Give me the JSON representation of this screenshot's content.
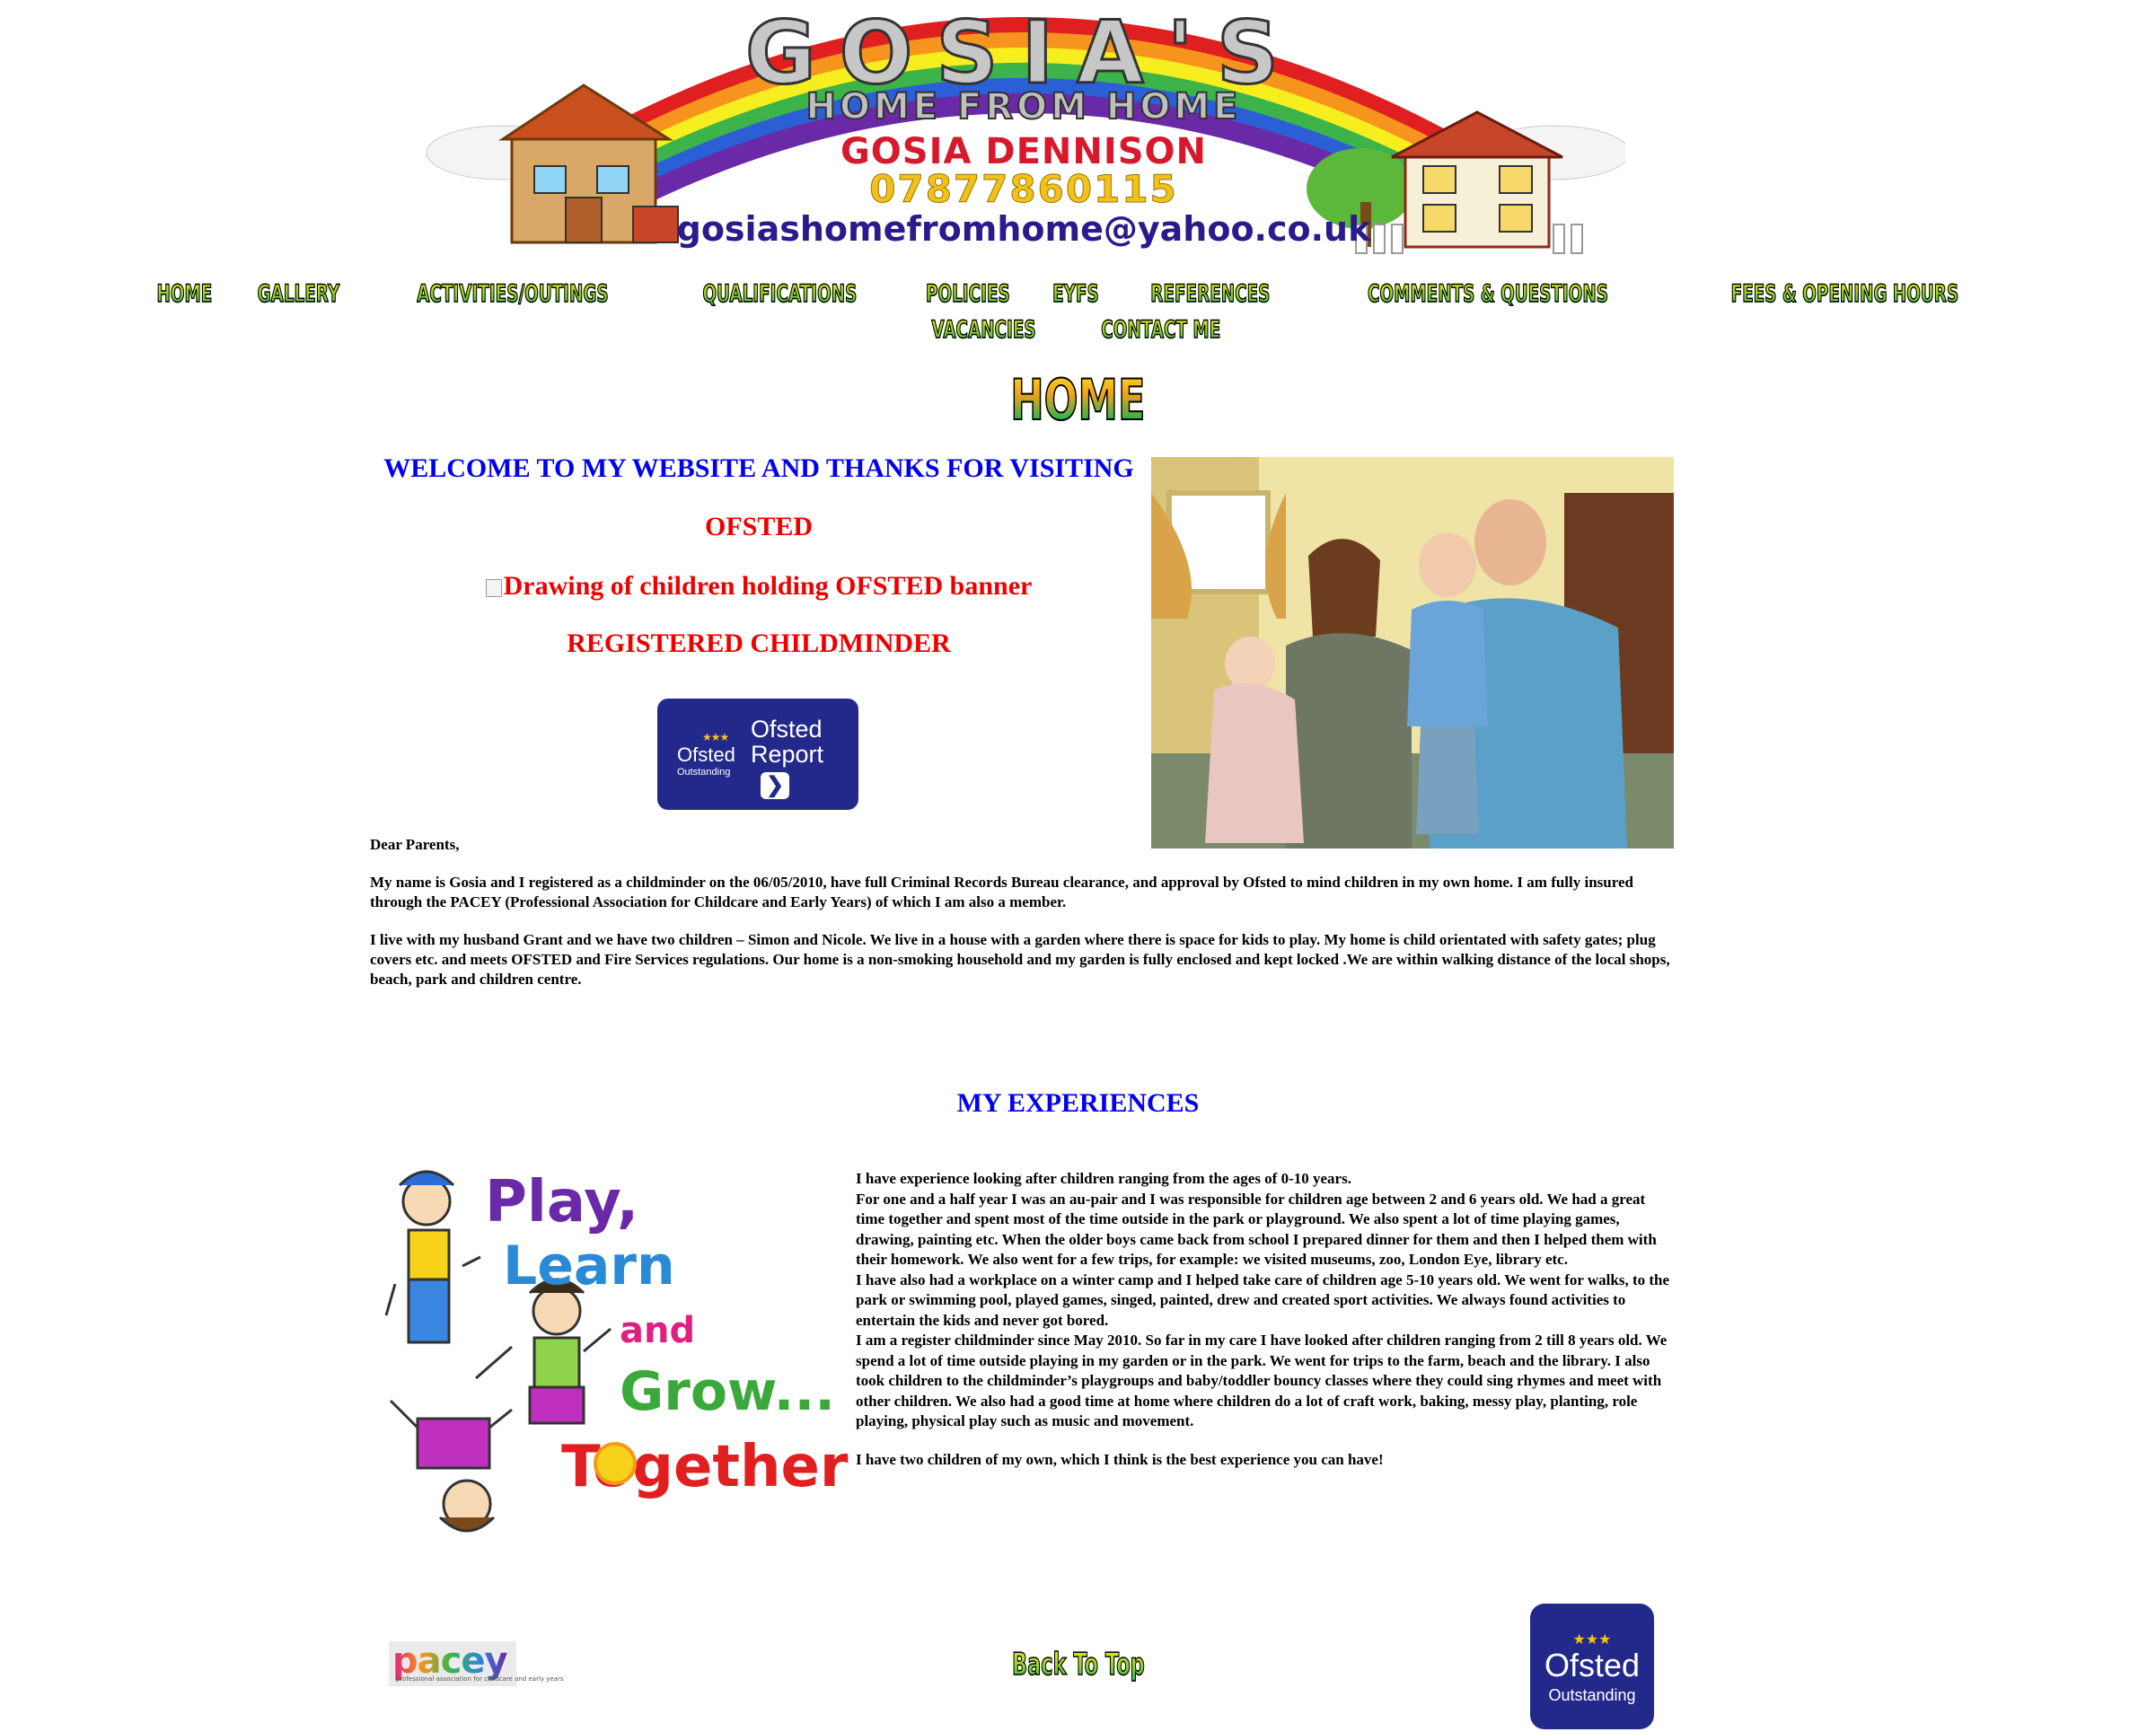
{
  "banner": {
    "title": "GOSIA'S",
    "subtitle": "HOME FROM HOME",
    "name": "GOSIA DENNISON",
    "phone": "07877860115",
    "email": "gosiashomefromhome@yahoo.co.uk"
  },
  "nav": {
    "row1": [
      "HOME",
      "GALLERY",
      "ACTIVITIES/OUTINGS",
      "QUALIFICATIONS",
      "POLICIES",
      "EYFS",
      "REFERENCES",
      "COMMENTS & QUESTIONS",
      "FEES & OPENING HOURS"
    ],
    "row2": [
      "VACANCIES",
      "CONTACT ME"
    ]
  },
  "page_heading": "HOME",
  "welcome": {
    "heading": "WELCOME TO MY WEBSITE AND THANKS FOR VISITING",
    "ofsted": "OFSTED",
    "ofsted_image_alt": "Drawing of children holding OFSTED banner",
    "registered": "REGISTERED CHILDMINDER"
  },
  "ofsted_report_button": {
    "logo": "Ofsted",
    "logo_sub": "Outstanding",
    "label_1": "Ofsted",
    "label_2": "Report",
    "icon": "chevron-right-icon"
  },
  "intro": {
    "greeting": "Dear Parents,",
    "paragraph_1": "My name is Gosia and I registered as a childminder on the 06/05/2010, have full Criminal Records Bureau clearance, and approval by Ofsted to mind children in my own home. I am fully insured through the PACEY (Professional Association for Childcare and Early Years) of which I am also a member.",
    "paragraph_2": "I live with my husband Grant and we have two children – Simon and Nicole. We live in a house with a garden where there is space for kids to play. My home is child orientated with safety gates; plug covers etc. and meets OFSTED and Fire Services regulations. Our home is a non-smoking household and my garden is fully enclosed and kept locked .We are within walking distance of the local shops, beach, park and children centre."
  },
  "experiences": {
    "heading": "MY EXPERIENCES",
    "image_words": [
      "Play,",
      "Learn",
      "and",
      "Grow...",
      "Together!"
    ],
    "lines": [
      "I have experience looking after children ranging from the ages of 0-10 years.",
      "For one and a half year I was an au-pair and I was responsible for children age between 2 and 6 years old. We had a great time together and spent most of the time outside in the park or playground. We also spent a lot of time playing games, drawing, painting etc. When the older boys came back from school I prepared dinner for them and then I helped them with their homework. We also went for a few trips, for example: we visited museums, zoo, London Eye, library etc.",
      "I have also had a workplace on a winter camp and I helped take care of children age 5-10 years old. We went for walks, to the park or swimming pool, played games, singed, painted, drew and created sport activities. We always found activities to entertain the kids and never got bored.",
      "I am a register childminder since May 2010. So far in my care I have looked after children ranging from 2 till 8 years old. We spend a lot of time outside playing in my garden or in the park. We went for trips to the farm, beach and the library. I also took children to the childminder’s playgroups and baby/toddler bouncy classes where they could sing rhymes and meet with other children. We also had a good time at home where children do a lot of craft work, baking, messy play, planting, role playing, physical play such as music and movement."
    ],
    "closing": "I have two children of my own, which I think is the best experience you can have!"
  },
  "footer": {
    "pacey_logo": "pacey",
    "pacey_tagline": "professional association for childcare and early years",
    "back_to_top": "Back To Top",
    "ofsted_logo": "Ofsted",
    "ofsted_grade": "Outstanding"
  },
  "colors": {
    "link_blue": "#0000ee",
    "ofsted_red": "#ee0000",
    "ofsted_navy": "#23298a",
    "star_gold": "#f4c21a"
  }
}
